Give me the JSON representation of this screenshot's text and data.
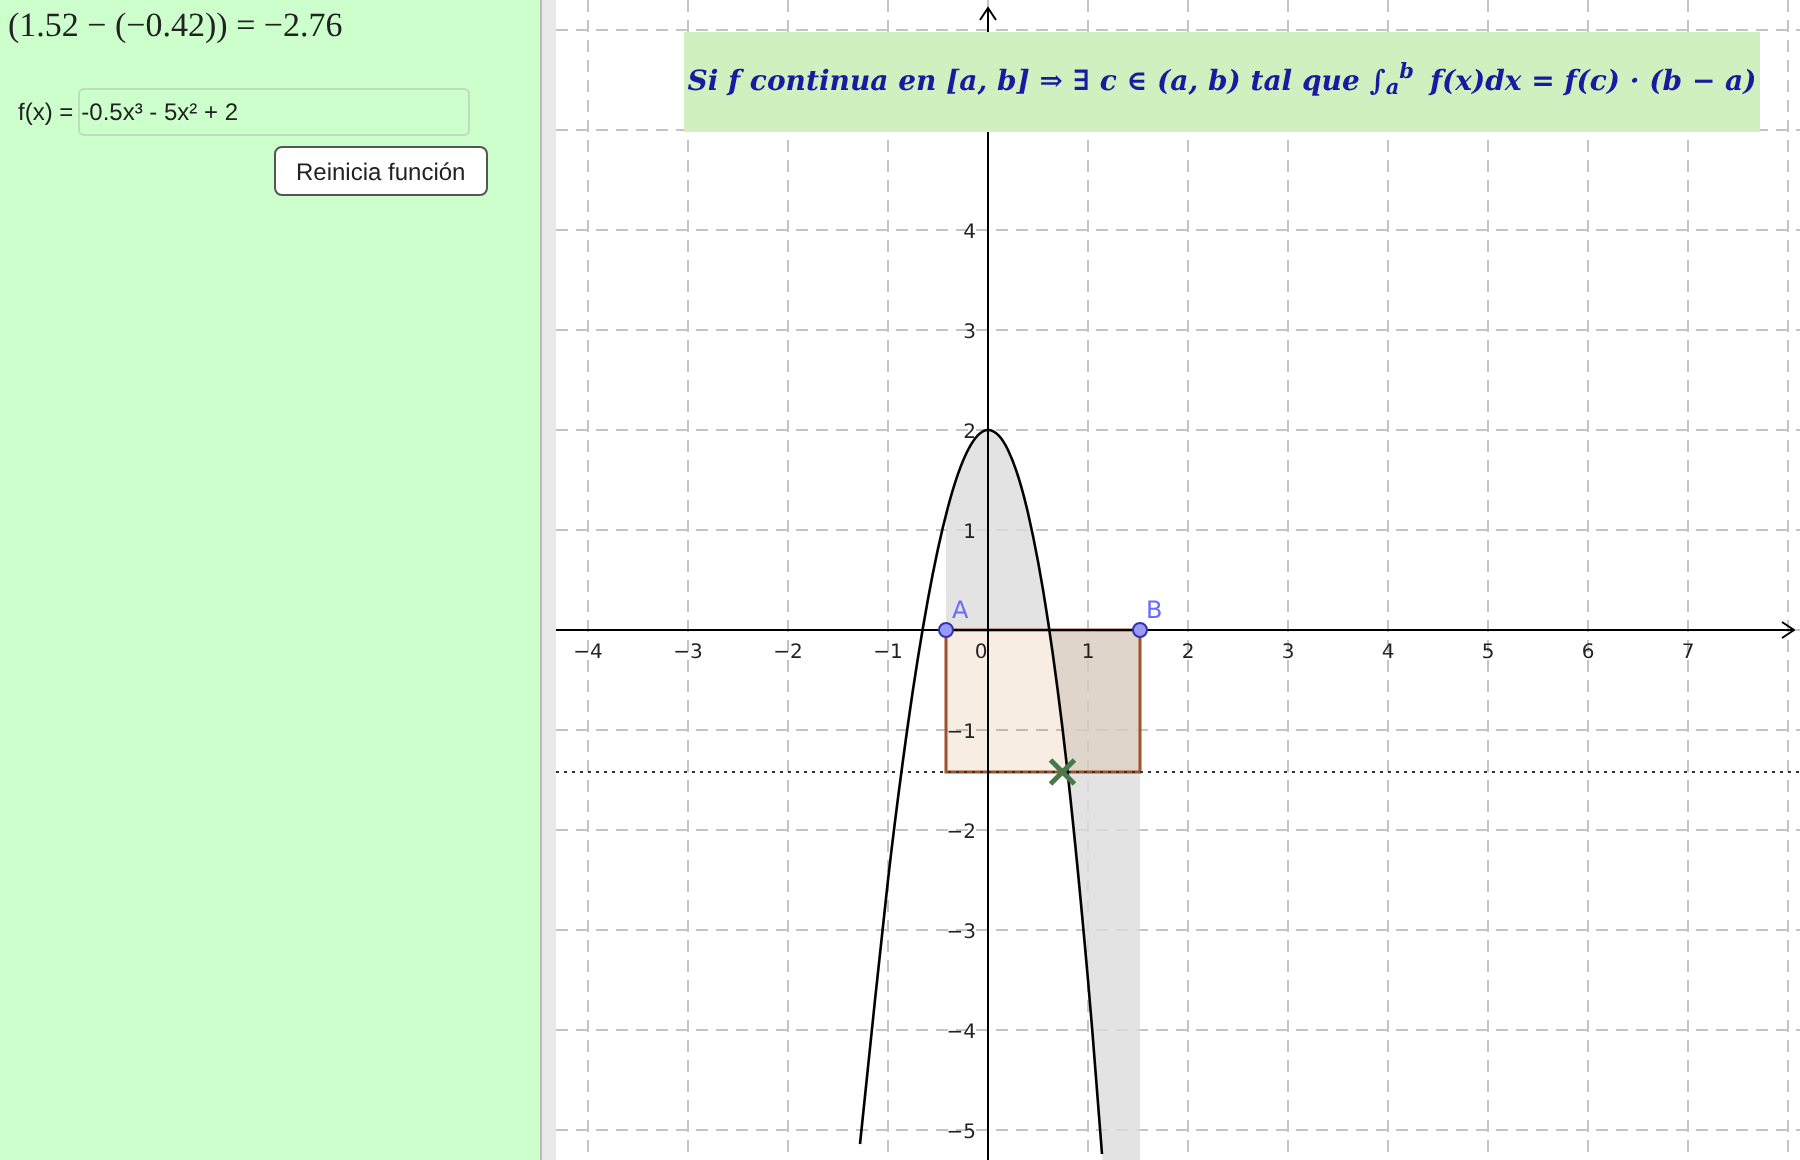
{
  "left_panel": {
    "result": "(1.52 − (−0.42)) = −2.76",
    "function_input": {
      "label": "f(x) =",
      "value": "-0.5x³ - 5x² + 2"
    },
    "reset_button": "Reinicia función"
  },
  "graph": {
    "banner": "Si f continua en [a, b] ⇒ ∃ c ∈ (a, b) tal que ∫$_{a}$$^{b}$ f(x)dx = f(c) · (b − a)",
    "points": [
      {
        "label": "A"
      },
      {
        "label": "B"
      }
    ],
    "chart_data": {
      "type": "line",
      "x": [
        -1.28,
        -1.0,
        -0.8,
        -0.6,
        -0.4,
        -0.2,
        0,
        0.2,
        0.4,
        0.6,
        0.8,
        1.0,
        1.14
      ],
      "series": [
        {
          "color": "#000000",
          "values": [
            -5.14,
            -2.5,
            -0.94,
            0.31,
            1.23,
            1.8,
            2,
            1.8,
            1.17,
            0.09,
            -1.46,
            -3.5,
            -5.24
          ]
        }
      ],
      "grid": true,
      "ref_lines": [
        {
          "axis": "y",
          "value": -1.42
        }
      ],
      "xlim": [
        -4.32,
        8.12
      ],
      "ylim": [
        -5.3,
        6.3
      ],
      "xticks": [
        {
          "value": -4,
          "label": "−4"
        },
        {
          "value": -3,
          "label": "−3"
        },
        {
          "value": -2,
          "label": "−2"
        },
        {
          "value": -1,
          "label": "−1"
        },
        {
          "value": 0,
          "label": "0"
        },
        1,
        2,
        3,
        4,
        5,
        6,
        7
      ],
      "yticks": [
        4,
        3,
        2,
        1,
        {
          "value": -1,
          "label": "−1"
        },
        {
          "value": -2,
          "label": "−2"
        },
        {
          "value": -3,
          "label": "−3"
        },
        {
          "value": -4,
          "label": "−4"
        },
        {
          "value": -5,
          "label": "−5"
        }
      ]
    }
  }
}
